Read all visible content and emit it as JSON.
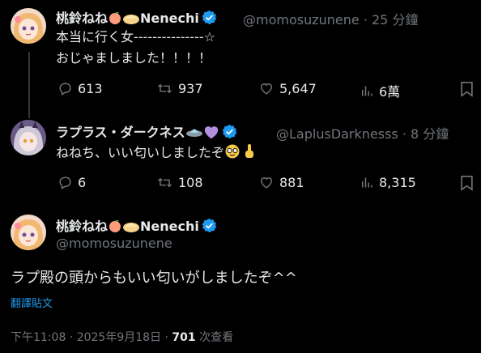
{
  "tweet1": {
    "name": "桃鈴ねね",
    "name_suffix": "Nenechi",
    "handle": "@momosuzunene",
    "time": "· 25 分鐘",
    "line1": "本当に行く女---------------☆",
    "line2": "おじゃましました！！！！",
    "replies": "613",
    "retweets": "937",
    "likes": "5,647",
    "views": "6萬"
  },
  "tweet2": {
    "name": "ラプラス・ダークネス",
    "handle": "@LaplusDarknesss",
    "time": "· 8 分鐘",
    "text": "ねねち、いい匂いしましたぞ",
    "replies": "6",
    "retweets": "108",
    "likes": "881",
    "views": "8,315"
  },
  "main": {
    "name": "桃鈴ねね",
    "name_suffix": "Nenechi",
    "handle": "@momosuzunene",
    "text": "ラプ殿の頭からもいい匂いがしましたぞ^^",
    "translate": "翻譯貼文",
    "timestamp": "下午11:08 · 2025年9月18日 · ",
    "view_count": "701",
    "view_label": " 次查看"
  },
  "colors": {
    "background": "#000000",
    "text": "#e7e9ea",
    "muted": "#71767b",
    "link": "#1d9bf0",
    "verified": "#1d9bf0"
  }
}
